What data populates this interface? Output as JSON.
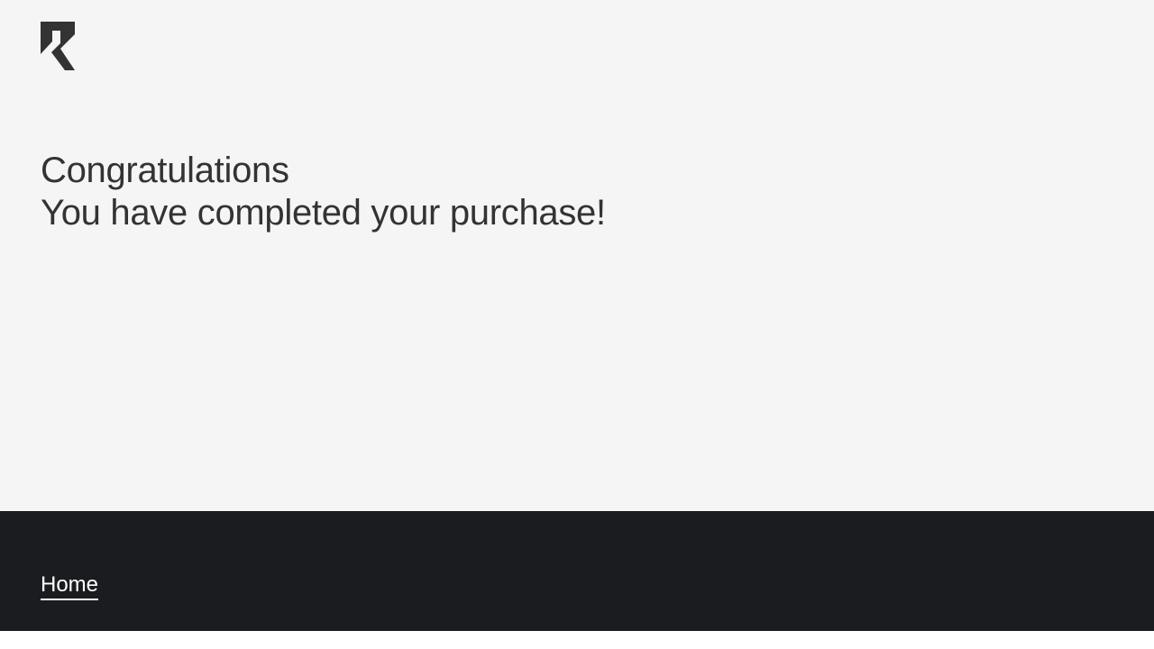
{
  "brand": {
    "logo_icon": "brand-r-logo-icon",
    "logo_color": "#333333"
  },
  "main": {
    "heading_line1": "Congratulations",
    "heading_line2": "You have completed your purchase!",
    "background_color": "#f5f5f5",
    "text_color": "#333333"
  },
  "footer": {
    "home_link_label": "Home",
    "background_color": "#1b1c1f",
    "link_color": "#ffffff"
  }
}
